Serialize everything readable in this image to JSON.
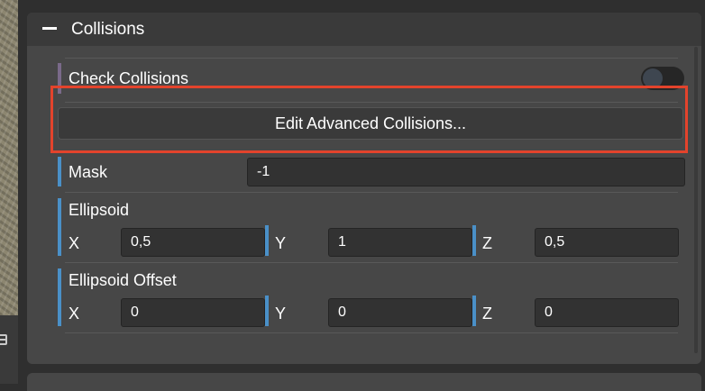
{
  "panel": {
    "title": "Collisions"
  },
  "check_collisions": {
    "label": "Check Collisions",
    "enabled": false
  },
  "edit_button": {
    "label": "Edit Advanced Collisions..."
  },
  "mask": {
    "label": "Mask",
    "value": "-1"
  },
  "ellipsoid": {
    "label": "Ellipsoid",
    "x": {
      "label": "X",
      "value": "0,5"
    },
    "y": {
      "label": "Y",
      "value": "1"
    },
    "z": {
      "label": "Z",
      "value": "0,5"
    }
  },
  "ellipsoid_offset": {
    "label": "Ellipsoid Offset",
    "x": {
      "label": "X",
      "value": "0"
    },
    "y": {
      "label": "Y",
      "value": "0"
    },
    "z": {
      "label": "Z",
      "value": "0"
    }
  },
  "colors": {
    "accent": "#4a90c8",
    "highlight": "#e3432c",
    "panel": "#474747"
  }
}
